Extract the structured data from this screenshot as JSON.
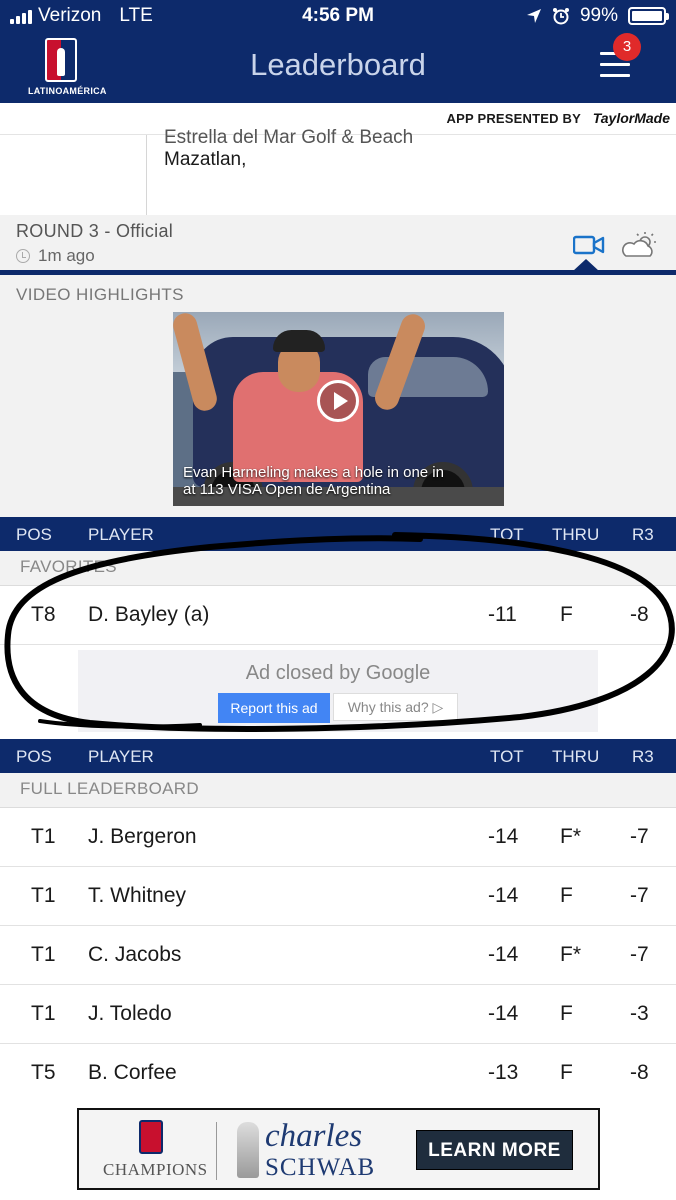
{
  "status_bar": {
    "carrier": "Verizon",
    "network": "LTE",
    "time": "4:56 PM",
    "battery": "99%",
    "battery_level": 0.99
  },
  "header": {
    "logo_text": "LATINOAMÉRICA",
    "title": "Leaderboard",
    "menu_badge": "3",
    "presented_by": "APP PRESENTED BY",
    "sponsor": "TaylorMade"
  },
  "tournament": {
    "course": "Estrella del Mar Golf & Beach",
    "city": "Mazatlan,"
  },
  "round": {
    "title": "ROUND 3 - Official",
    "updated": "1m ago"
  },
  "video": {
    "section_title": "VIDEO HIGHLIGHTS",
    "caption_line1": "Evan Harmeling makes a hole in one in",
    "caption_line2": "at 113 VISA Open de Argentina"
  },
  "columns": {
    "pos": "POS",
    "player": "PLAYER",
    "tot": "TOT",
    "thru": "THRU",
    "r3": "R3"
  },
  "favorites": {
    "section_title": "FAVORITES",
    "rows": [
      {
        "pos": "T8",
        "name": "D. Bayley (a)",
        "tot": "-11",
        "thru": "F",
        "r3": "-8"
      }
    ]
  },
  "ad": {
    "message": "Ad closed by Google",
    "report": "Report this ad",
    "why": "Why this ad? ▷"
  },
  "leaderboard": {
    "section_title": "FULL LEADERBOARD",
    "rows": [
      {
        "pos": "T1",
        "name": "J. Bergeron",
        "tot": "-14",
        "thru": "F*",
        "r3": "-7"
      },
      {
        "pos": "T1",
        "name": "T. Whitney",
        "tot": "-14",
        "thru": "F",
        "r3": "-7"
      },
      {
        "pos": "T1",
        "name": "C. Jacobs",
        "tot": "-14",
        "thru": "F*",
        "r3": "-7"
      },
      {
        "pos": "T1",
        "name": "J. Toledo",
        "tot": "-14",
        "thru": "F",
        "r3": "-3"
      },
      {
        "pos": "T5",
        "name": "B. Corfee",
        "tot": "-13",
        "thru": "F",
        "r3": "-8"
      }
    ]
  },
  "banner": {
    "champions": "CHAMPIONS",
    "sponsor_line1": "charles",
    "sponsor_line2": "SCHWAB",
    "cta": "LEARN MORE"
  },
  "colors": {
    "navy": "#0d2a6b",
    "accent_blue": "#1a73c9",
    "badge_red": "#e02a2a"
  }
}
